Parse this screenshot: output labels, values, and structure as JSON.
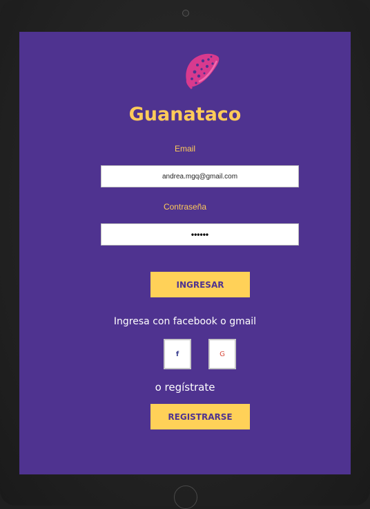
{
  "app": {
    "title": "Guanataco",
    "brand_color": "#ffcb59",
    "background_color": "#4f3390",
    "logo_color": "#d83a8e"
  },
  "login": {
    "email_label": "Email",
    "email_value": "andrea.mgq@gmail.com",
    "password_label": "Contraseña",
    "password_value": "••••••",
    "submit_label": "INGRESAR"
  },
  "social": {
    "prompt": "Ingresa con facebook o gmail",
    "facebook_glyph": "f",
    "facebook_icon": "facebook-icon",
    "google_glyph": "G",
    "google_icon": "google-icon"
  },
  "register": {
    "prompt": "o regístrate",
    "button_label": "REGISTRARSE"
  }
}
